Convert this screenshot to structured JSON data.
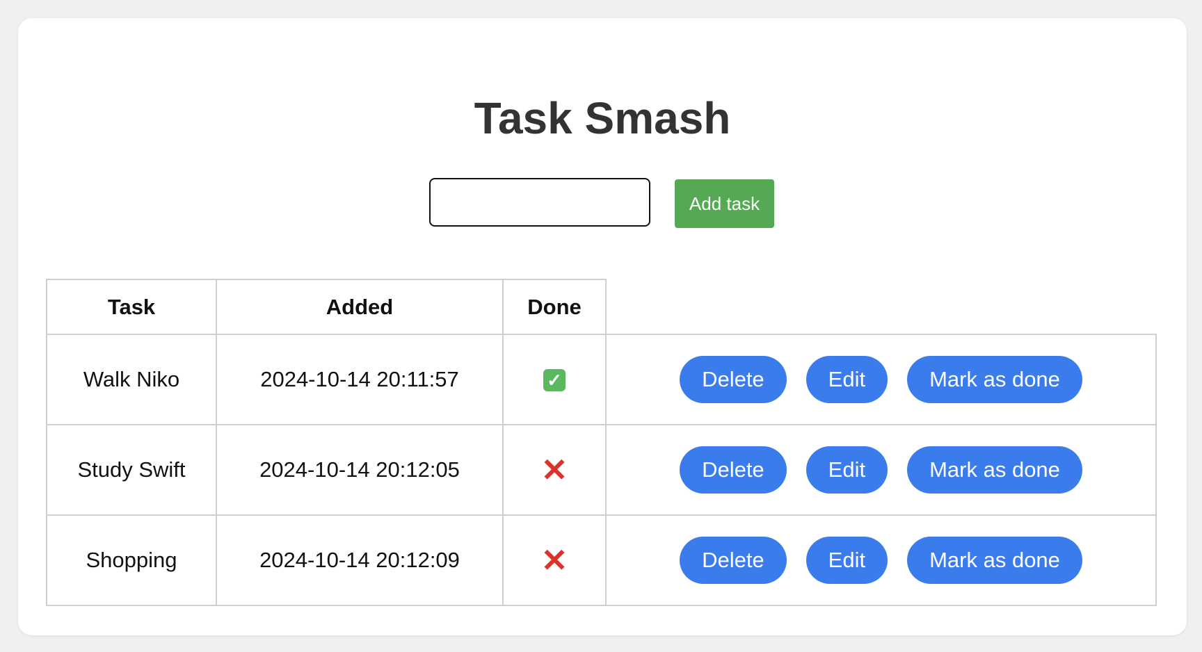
{
  "colors": {
    "page_bg": "#f0f0f0",
    "card_bg": "#ffffff",
    "accent_green": "#55a954",
    "accent_blue": "#3b7ced",
    "done_green": "#5cb85c",
    "not_done_red": "#d9342b"
  },
  "header": {
    "title": "Task Smash"
  },
  "add_form": {
    "input_value": "",
    "input_placeholder": "",
    "button_label": "Add task"
  },
  "table": {
    "columns": [
      "Task",
      "Added",
      "Done",
      ""
    ],
    "rows": [
      {
        "task": "Walk Niko",
        "added": "2024-10-14 20:11:57",
        "done": true,
        "done_icon": "check-mark-icon",
        "done_symbol": "✓",
        "delete_label": "Delete",
        "edit_label": "Edit",
        "mark_label": "Mark as done"
      },
      {
        "task": "Study Swift",
        "added": "2024-10-14 20:12:05",
        "done": false,
        "done_icon": "cross-mark-icon",
        "done_symbol": "✕",
        "delete_label": "Delete",
        "edit_label": "Edit",
        "mark_label": "Mark as done"
      },
      {
        "task": "Shopping",
        "added": "2024-10-14 20:12:09",
        "done": false,
        "done_icon": "cross-mark-icon",
        "done_symbol": "✕",
        "delete_label": "Delete",
        "edit_label": "Edit",
        "mark_label": "Mark as done"
      }
    ]
  }
}
